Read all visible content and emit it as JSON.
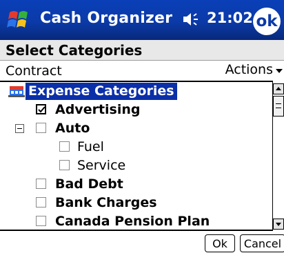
{
  "titlebar": {
    "app_title": "Cash Organizer",
    "clock": "21:02",
    "ok_label": "ok",
    "start_icon": "windows-flag-icon",
    "volume_icon": "speaker-icon"
  },
  "header": {
    "title": "Select Categories"
  },
  "toolbar": {
    "left_label": "Contract",
    "actions_label": "Actions"
  },
  "tree": {
    "root_label": "Expense Categories",
    "items": [
      {
        "label": "Advertising",
        "checked": true,
        "bold": true,
        "level": 0,
        "expander": false
      },
      {
        "label": "Auto",
        "checked": false,
        "bold": true,
        "level": 0,
        "expander": true
      },
      {
        "label": "Fuel",
        "checked": false,
        "bold": false,
        "level": 1,
        "expander": false
      },
      {
        "label": "Service",
        "checked": false,
        "bold": false,
        "level": 1,
        "expander": false
      },
      {
        "label": "Bad Debt",
        "checked": false,
        "bold": true,
        "level": 0,
        "expander": false
      },
      {
        "label": "Bank Charges",
        "checked": false,
        "bold": true,
        "level": 0,
        "expander": false
      },
      {
        "label": "Canada Pension Plan",
        "checked": false,
        "bold": true,
        "level": 0,
        "expander": false
      }
    ]
  },
  "buttons": {
    "ok_label": "Ok",
    "cancel_label": "Cancel"
  },
  "colors": {
    "titlebar": "#0b3aa8",
    "selection": "#0b2fa8"
  }
}
